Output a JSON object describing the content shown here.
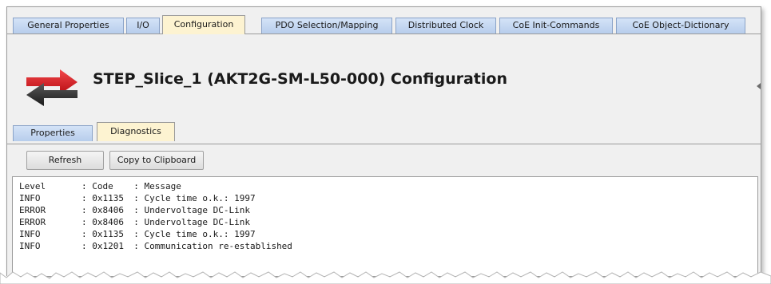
{
  "tabs": [
    {
      "label": "General Properties",
      "active": false
    },
    {
      "label": "I/O",
      "active": false
    },
    {
      "label": "Configuration",
      "active": true
    },
    {
      "label": "PDO Selection/Mapping",
      "active": false
    },
    {
      "label": "Distributed Clock",
      "active": false
    },
    {
      "label": "CoE Init-Commands",
      "active": false
    },
    {
      "label": "CoE Object-Dictionary",
      "active": false
    }
  ],
  "header": {
    "title": "STEP_Slice_1 (AKT2G-SM-L50-000) Configuration",
    "icon": "exchange-arrows-icon"
  },
  "subtabs": [
    {
      "label": "Properties",
      "active": false
    },
    {
      "label": "Diagnostics",
      "active": true
    }
  ],
  "buttons": {
    "refresh": "Refresh",
    "copy": "Copy to Clipboard"
  },
  "log": {
    "header": {
      "level": "Level",
      "code": "Code",
      "message": "Message"
    },
    "rows": [
      {
        "level": "INFO",
        "code": "0x1135",
        "message": "Cycle time o.k.: 1997"
      },
      {
        "level": "ERROR",
        "code": "0x8406",
        "message": "Undervoltage DC-Link"
      },
      {
        "level": "ERROR",
        "code": "0x8406",
        "message": "Undervoltage DC-Link"
      },
      {
        "level": "INFO",
        "code": "0x1135",
        "message": "Cycle time o.k.: 1997"
      },
      {
        "level": "INFO",
        "code": "0x1201",
        "message": "Communication re-established"
      }
    ]
  },
  "colors": {
    "tab_inactive": "#c5d8f1",
    "tab_active": "#fdf3d1",
    "icon_red": "#d6161c",
    "icon_dark": "#2b2b2b"
  }
}
